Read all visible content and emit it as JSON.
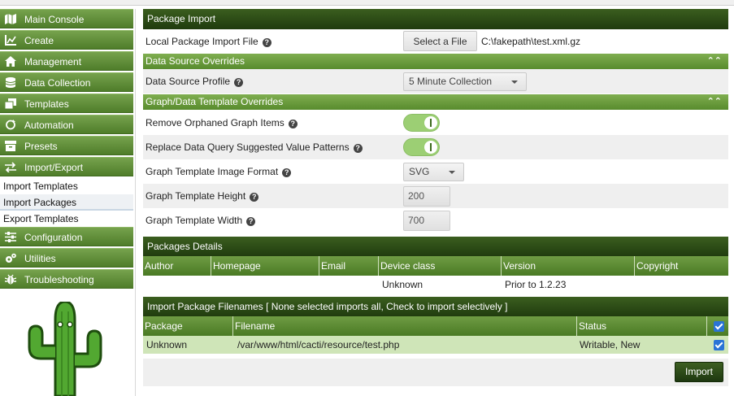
{
  "sidebar": {
    "items": [
      {
        "label": "Main Console",
        "icon": "map-icon"
      },
      {
        "label": "Create",
        "icon": "chart-icon"
      },
      {
        "label": "Management",
        "icon": "home-icon"
      },
      {
        "label": "Data Collection",
        "icon": "database-icon"
      },
      {
        "label": "Templates",
        "icon": "copy-icon"
      },
      {
        "label": "Automation",
        "icon": "refresh-icon"
      },
      {
        "label": "Presets",
        "icon": "archive-icon"
      },
      {
        "label": "Import/Export",
        "icon": "exchange-icon"
      }
    ],
    "sub_items": [
      "Import Templates",
      "Import Packages",
      "Export Templates"
    ],
    "items_after": [
      {
        "label": "Configuration",
        "icon": "sliders-icon"
      },
      {
        "label": "Utilities",
        "icon": "cogs-icon"
      },
      {
        "label": "Troubleshooting",
        "icon": "bug-icon"
      }
    ]
  },
  "package_import": {
    "title": "Package Import",
    "file_label": "Local Package Import File",
    "select_button": "Select a File",
    "file_value": "C:\\fakepath\\test.xml.gz"
  },
  "data_source": {
    "title": "Data Source Overrides",
    "profile_label": "Data Source Profile",
    "profile_value": "5 Minute Collection"
  },
  "graph_template": {
    "title": "Graph/Data Template Overrides",
    "remove_orphaned_label": "Remove Orphaned Graph Items",
    "replace_patterns_label": "Replace Data Query Suggested Value Patterns",
    "image_format_label": "Graph Template Image Format",
    "image_format_value": "SVG",
    "height_label": "Graph Template Height",
    "height_value": "200",
    "width_label": "Graph Template Width",
    "width_value": "700"
  },
  "packages_details": {
    "title": "Packages Details",
    "columns": [
      "Author",
      "Homepage",
      "Email",
      "Device class",
      "Version",
      "Copyright"
    ],
    "row": [
      "",
      "",
      "",
      "Unknown",
      "Prior to 1.2.23",
      ""
    ]
  },
  "filenames": {
    "title": "Import Package Filenames [ None selected imports all, Check to import selectively ]",
    "columns": [
      "Package",
      "Filename",
      "Status"
    ],
    "row": [
      "Unknown",
      "/var/www/html/cacti/resource/test.php",
      "Writable, New"
    ]
  },
  "import_button": "Import",
  "colors": {
    "header_dark": "#2d4a16",
    "accent_green": "#6a9a3f",
    "toggle_on": "#9ccf74",
    "checkbox": "#2a73d6"
  }
}
